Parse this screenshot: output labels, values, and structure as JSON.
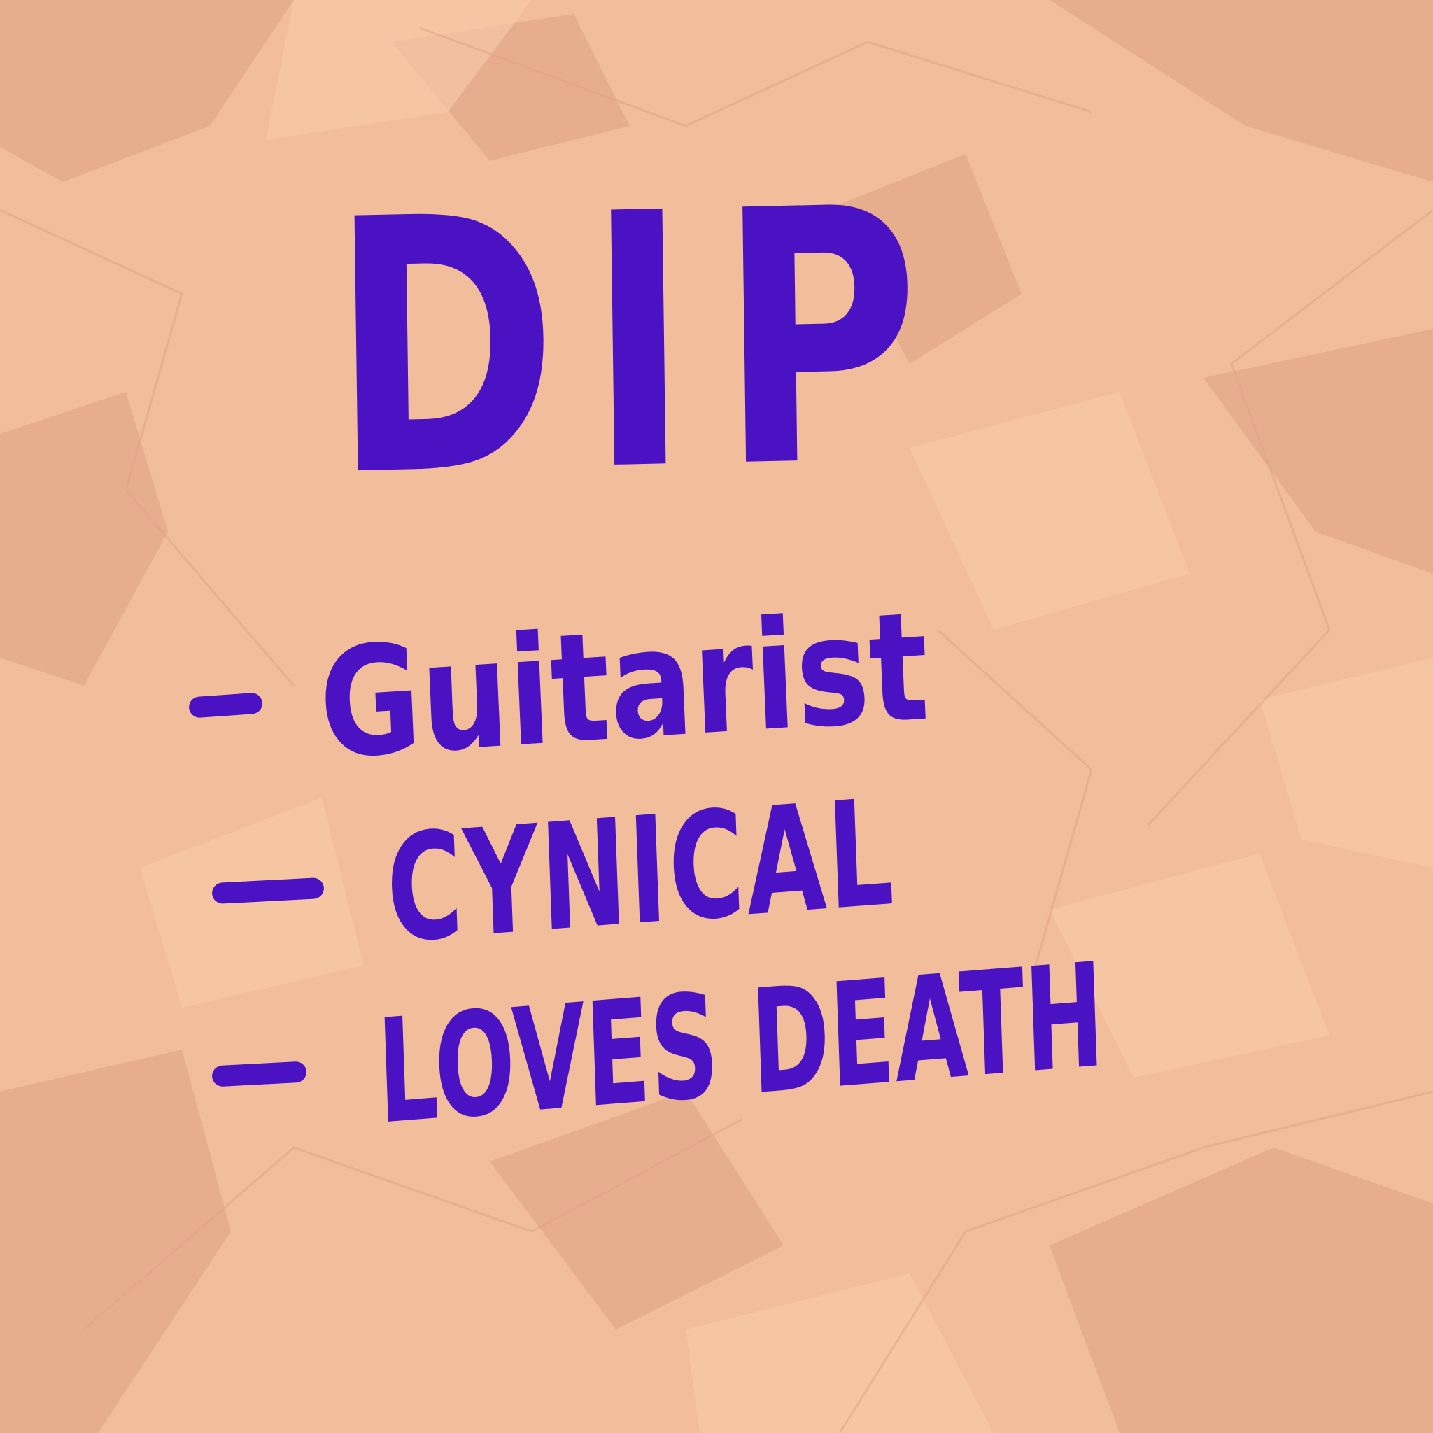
{
  "paper": {
    "background_color": "#f2bd9b",
    "shadow_color": "#dea283",
    "highlight_color": "#f8cba9"
  },
  "ink_color": "#4a12c2",
  "note": {
    "title": "DIP",
    "items": [
      {
        "bullet": "-",
        "text": "Guitarist"
      },
      {
        "bullet": "-",
        "text": "CYNICAL"
      },
      {
        "bullet": "-",
        "text": "LOVES DEATH"
      }
    ]
  }
}
